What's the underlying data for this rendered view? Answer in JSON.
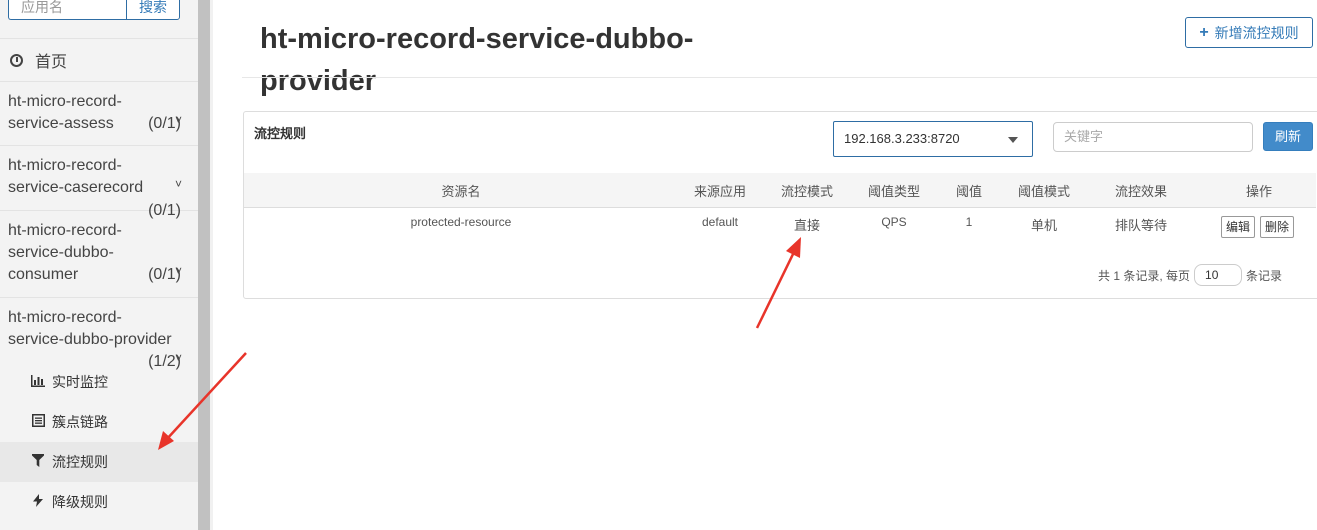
{
  "sidebar": {
    "search_placeholder": "应用名",
    "search_button": "搜索",
    "home": "首页",
    "apps": [
      {
        "name_line1": "ht-micro-record-",
        "name_line2": "service-assess",
        "count": "(0/1)"
      },
      {
        "name_line1": "ht-micro-record-",
        "name_line2": "service-caserecord",
        "count": "(0/1)"
      },
      {
        "name_line1": "ht-micro-record-",
        "name_line2": "service-dubbo-",
        "name_line3": "consumer",
        "count": "(0/1)"
      },
      {
        "name_line1": "ht-micro-record-",
        "name_line2": "service-dubbo-provider",
        "count": "(1/2)"
      }
    ],
    "submenu": [
      {
        "label": "实时监控",
        "icon": "bar-chart-icon"
      },
      {
        "label": "簇点链路",
        "icon": "list-icon"
      },
      {
        "label": "流控规则",
        "icon": "filter-icon"
      },
      {
        "label": "降级规则",
        "icon": "flash-icon"
      }
    ],
    "chevron": "˅"
  },
  "header": {
    "title_line1": "ht-micro-record-service-dubbo-",
    "title_line2": "provider",
    "add_button": "新增流控规则"
  },
  "panel": {
    "title": "流控规则",
    "machine_select": "192.168.3.233:8720",
    "keyword_placeholder": "关键字",
    "refresh_button": "刷新",
    "columns": [
      "资源名",
      "来源应用",
      "流控模式",
      "阈值类型",
      "阈值",
      "阈值模式",
      "流控效果",
      "操作"
    ],
    "rows": [
      {
        "resource": "protected-resource",
        "origin": "default",
        "mode": "直接",
        "grade": "QPS",
        "count": "1",
        "cluster": "单机",
        "effect": "排队等待",
        "edit": "编辑",
        "delete": "删除"
      }
    ],
    "pager": {
      "prefix": "共 1 条记录, 每页",
      "size": "10",
      "suffix": "条记录"
    }
  },
  "colors": {
    "accent": "#337ab7",
    "primary_button": "#428bca",
    "arrow": "#e8342a"
  }
}
